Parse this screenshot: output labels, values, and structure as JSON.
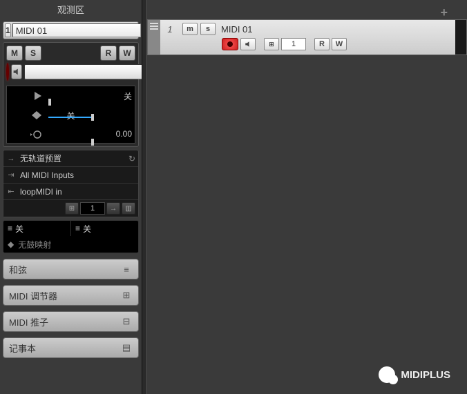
{
  "inspector": {
    "title": "观测区",
    "track_number": "1",
    "track_name": "MIDI 01",
    "mute_label": "M",
    "solo_label": "S",
    "read_label": "R",
    "write_label": "W",
    "meter_off_1": "关",
    "meter_off_2": "关",
    "meter_value": "0.00",
    "preset_label": "无轨道预置",
    "input_label": "All MIDI Inputs",
    "output_label": "loopMIDI in",
    "channel_value": "1",
    "off_cell_1": "关",
    "off_cell_2": "关",
    "drum_map_label": "无鼓映射"
  },
  "sections": {
    "chord": "和弦",
    "midi_modifier": "MIDI 调节器",
    "midi_fader": "MIDI 推子",
    "notepad": "记事本"
  },
  "arrange": {
    "track_number": "1",
    "track_name": "MIDI 01",
    "mute_label": "m",
    "solo_label": "s",
    "read_label": "R",
    "write_label": "W",
    "channel_value": "1"
  },
  "watermark": {
    "text": "MIDIPLUS"
  }
}
